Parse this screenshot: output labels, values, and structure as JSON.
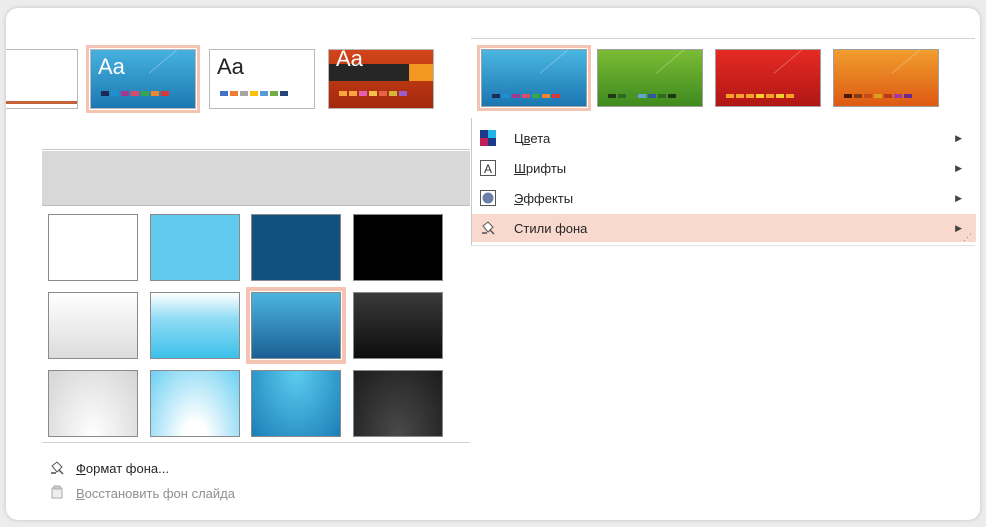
{
  "theme_gallery": {
    "thumbs": [
      {
        "id": "partial-white",
        "label": ""
      },
      {
        "id": "blue-theme",
        "label": "Aa"
      },
      {
        "id": "white-theme",
        "label": "Aa"
      },
      {
        "id": "orange-theme",
        "label": "Aa"
      }
    ],
    "scroll": {
      "up": "▲",
      "down": "▼",
      "more": "▾"
    }
  },
  "variants": [
    {
      "id": "variant-blue"
    },
    {
      "id": "variant-green"
    },
    {
      "id": "variant-red"
    },
    {
      "id": "variant-orange"
    }
  ],
  "dropdown_menu": {
    "items": [
      {
        "label_pre": "Ц",
        "label_u": "в",
        "label_post": "ета",
        "icon": "colors-icon"
      },
      {
        "label_pre": "",
        "label_u": "Ш",
        "label_post": "рифты",
        "icon": "fonts-icon"
      },
      {
        "label_pre": "",
        "label_u": "Э",
        "label_post": "ффекты",
        "icon": "effects-icon"
      },
      {
        "label_pre": "",
        "label_u": "С",
        "label_post": "тили фона",
        "icon": "background-styles-icon"
      }
    ],
    "arrow": "▶",
    "grip": "⋰"
  },
  "background_styles": {
    "selected_index": 6,
    "actions": {
      "format_u": "Ф",
      "format_rest": "ормат фона...",
      "reset_u": "В",
      "reset_rest": "осстановить фон слайда"
    }
  },
  "colors": {
    "accent_highlight": "#f9d9cd",
    "selection_outline": "#f3c4b4"
  }
}
